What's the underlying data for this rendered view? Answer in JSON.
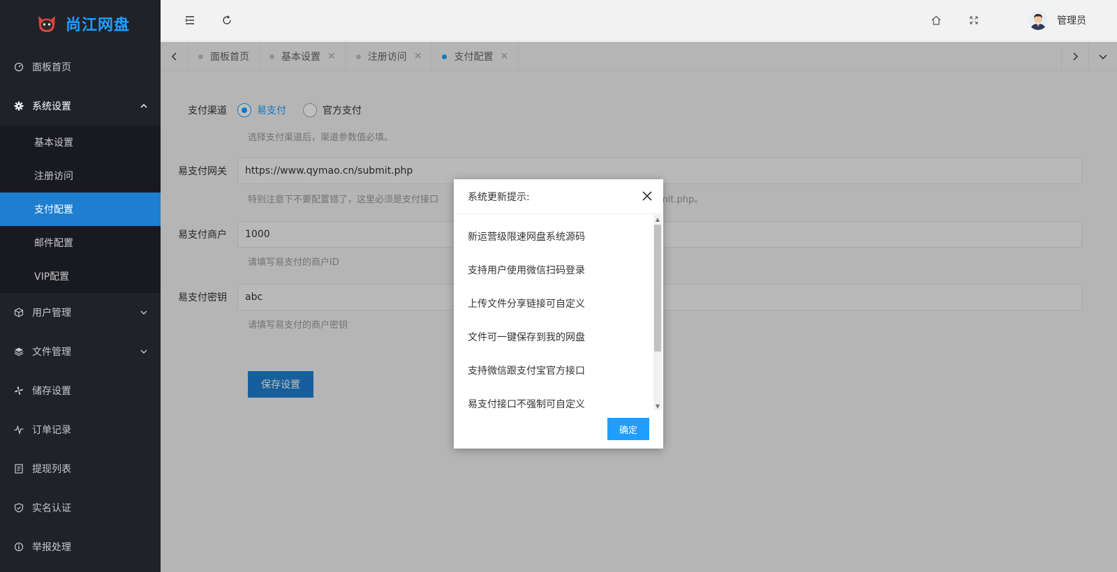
{
  "app": {
    "logo_text": "尚江网盘"
  },
  "sidebar": {
    "items": [
      {
        "label": "面板首页",
        "icon": "dashboard-icon"
      },
      {
        "label": "系统设置",
        "icon": "gear-icon"
      },
      {
        "label": "用户管理",
        "icon": "cube-icon"
      },
      {
        "label": "文件管理",
        "icon": "layers-icon"
      },
      {
        "label": "储存设置",
        "icon": "fan-icon"
      },
      {
        "label": "订单记录",
        "icon": "pulse-icon"
      },
      {
        "label": "提现列表",
        "icon": "list-icon"
      },
      {
        "label": "实名认证",
        "icon": "shield-check-icon"
      },
      {
        "label": "举报处理",
        "icon": "info-icon"
      }
    ],
    "sub_items": [
      {
        "label": "基本设置"
      },
      {
        "label": "注册访问"
      },
      {
        "label": "支付配置"
      },
      {
        "label": "邮件配置"
      },
      {
        "label": "VIP配置"
      }
    ]
  },
  "header": {
    "admin_name": "管理员"
  },
  "tabs": [
    {
      "label": "面板首页"
    },
    {
      "label": "基本设置"
    },
    {
      "label": "注册访问"
    },
    {
      "label": "支付配置"
    }
  ],
  "form": {
    "channel_label": "支付渠道",
    "channel_options": [
      "易支付",
      "官方支付"
    ],
    "channel_hint": "选择支付渠道后，渠道参数值必填。",
    "gateway_label": "易支付网关",
    "gateway_value": "https://www.qymao.cn/submit.php",
    "gateway_hint_left": "特别注意下不要配置错了，这里必须是支付接口",
    "gateway_hint_right": "mit.php。",
    "merchant_label": "易支付商户",
    "merchant_value": "1000",
    "merchant_hint": "请填写易支付的商户ID",
    "key_label": "易支付密钥",
    "key_value": "abc",
    "key_hint": "请填写易支付的商户密钥",
    "save_label": "保存设置"
  },
  "modal": {
    "title": "系统更新提示:",
    "items": [
      "新运营级限速网盘系统源码",
      "支持用户使用微信扫码登录",
      "上传文件分享链接可自定义",
      "文件可一键保存到我的网盘",
      "支持微信跟支付宝官方接口",
      "易支付接口不强制可自定义"
    ],
    "ok_label": "确定"
  },
  "colors": {
    "accent": "#1e9fff",
    "active_nav": "#1e7fd0",
    "sidebar_bg": "#20222a"
  }
}
